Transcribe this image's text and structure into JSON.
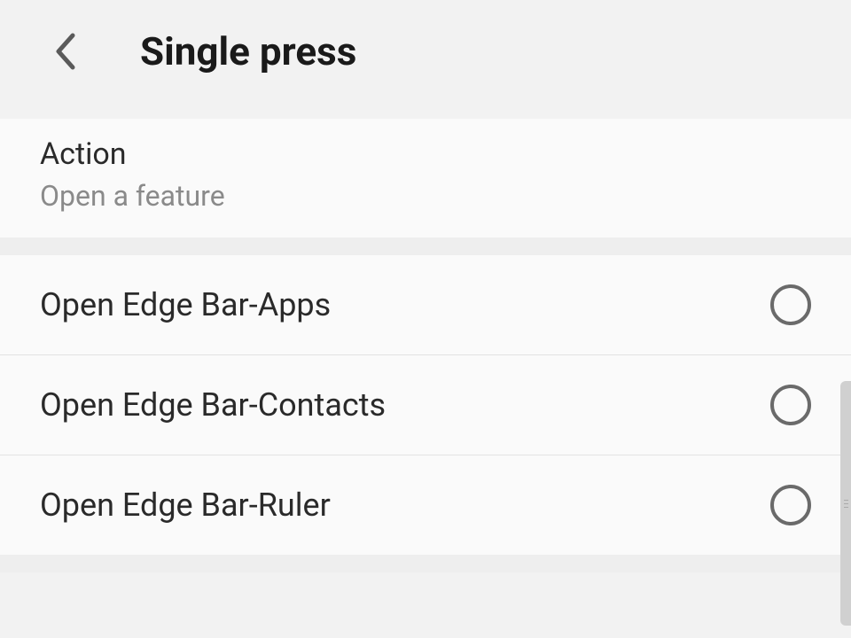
{
  "header": {
    "title": "Single press"
  },
  "section": {
    "label": "Action",
    "subtitle": "Open a feature"
  },
  "options": [
    {
      "label": "Open Edge Bar-Apps"
    },
    {
      "label": "Open Edge Bar-Contacts"
    },
    {
      "label": "Open Edge Bar-Ruler"
    }
  ]
}
